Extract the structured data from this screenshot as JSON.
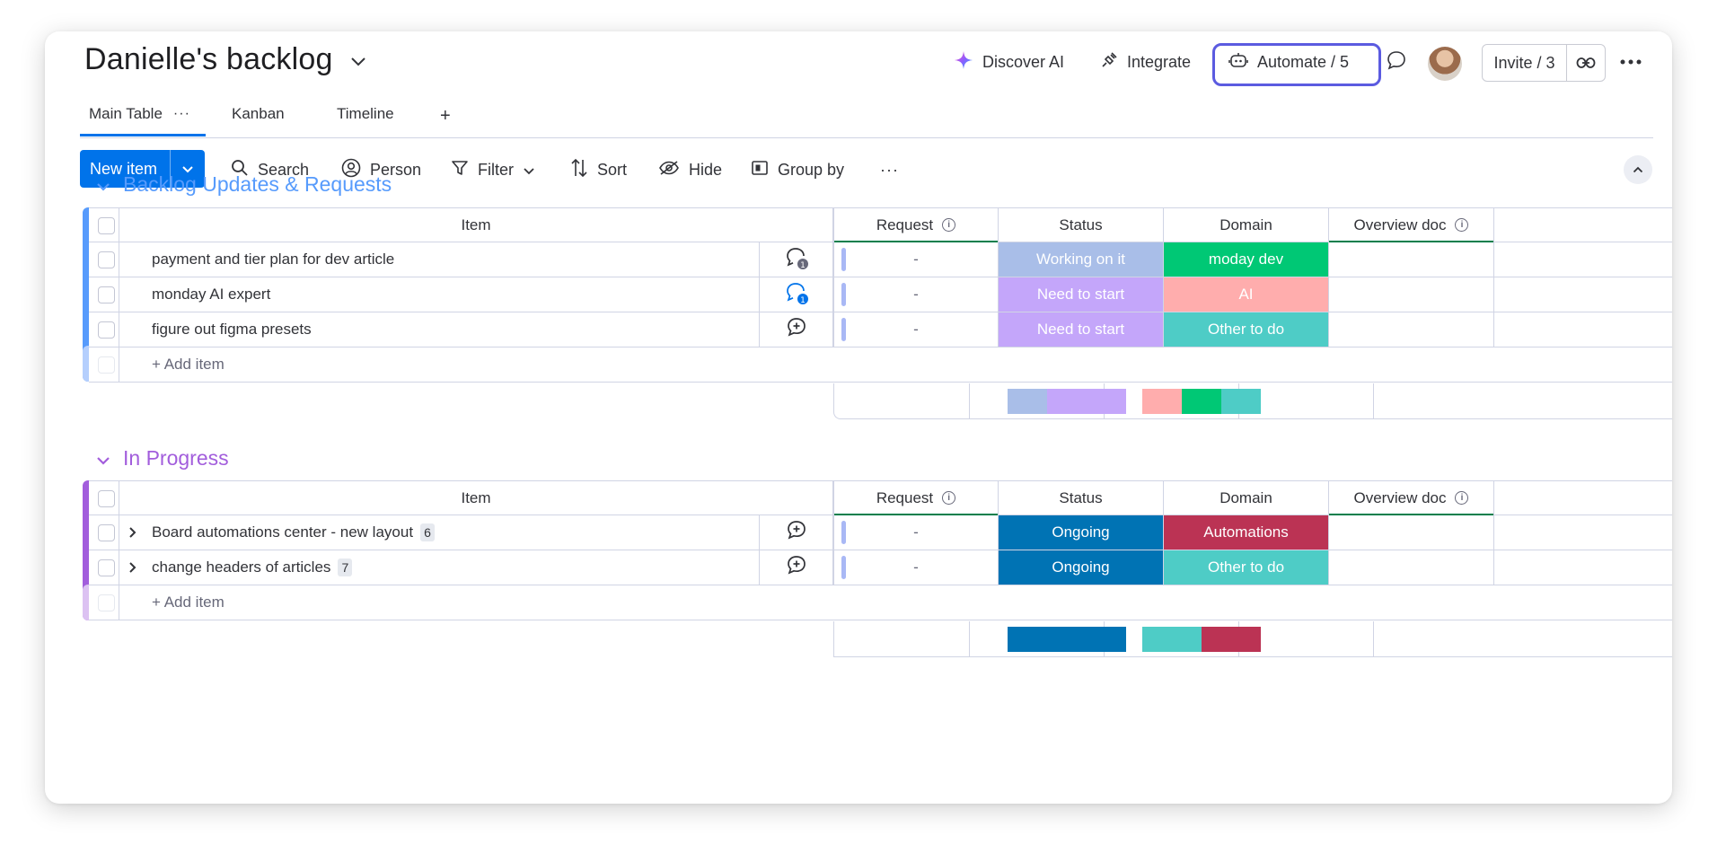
{
  "header": {
    "board_title": "Danielle's backlog",
    "discover_ai": "Discover AI",
    "integrate": "Integrate",
    "automate": "Automate / 5",
    "invite": "Invite / 3"
  },
  "tabs": [
    {
      "label": "Main Table",
      "active": true
    },
    {
      "label": "Kanban",
      "active": false
    },
    {
      "label": "Timeline",
      "active": false
    }
  ],
  "toolbar": {
    "new_item": "New item",
    "search": "Search",
    "person": "Person",
    "filter": "Filter",
    "sort": "Sort",
    "hide": "Hide",
    "group_by": "Group by"
  },
  "columns": {
    "item": "Item",
    "request": "Request",
    "status": "Status",
    "domain": "Domain",
    "overview_doc": "Overview doc"
  },
  "groups": [
    {
      "title": "Backlog Updates & Requests",
      "color": "#579bfc",
      "bar_color": "#579bfc",
      "add_item": "+ Add item",
      "rows": [
        {
          "item": "payment and tier plan for dev article",
          "request": "-",
          "status": "Working on it",
          "status_color": "#a9bee8",
          "domain": "moday dev",
          "domain_color": "#00c875",
          "update_count": "1"
        },
        {
          "item": "monday AI expert",
          "request": "-",
          "status": "Need to start",
          "status_color": "#c4a6fa",
          "domain": "AI",
          "domain_color": "#ffadad",
          "update_count": "1"
        },
        {
          "item": "figure out figma presets",
          "request": "-",
          "status": "Need to start",
          "status_color": "#c4a6fa",
          "domain": "Other to do",
          "domain_color": "#4eccc6",
          "update_count": ""
        }
      ]
    },
    {
      "title": "In Progress",
      "color": "#a25ddc",
      "bar_color": "#a25ddc",
      "add_item": "+ Add item",
      "rows": [
        {
          "item": "Board automations center - new layout",
          "subitems": "6",
          "request": "-",
          "status": "Ongoing",
          "status_color": "#0073b4",
          "domain": "Automations",
          "domain_color": "#bb3354"
        },
        {
          "item": "change headers of articles",
          "subitems": "7",
          "request": "-",
          "status": "Ongoing",
          "status_color": "#0073b4",
          "domain": "Other to do",
          "domain_color": "#4eccc6"
        }
      ]
    }
  ]
}
